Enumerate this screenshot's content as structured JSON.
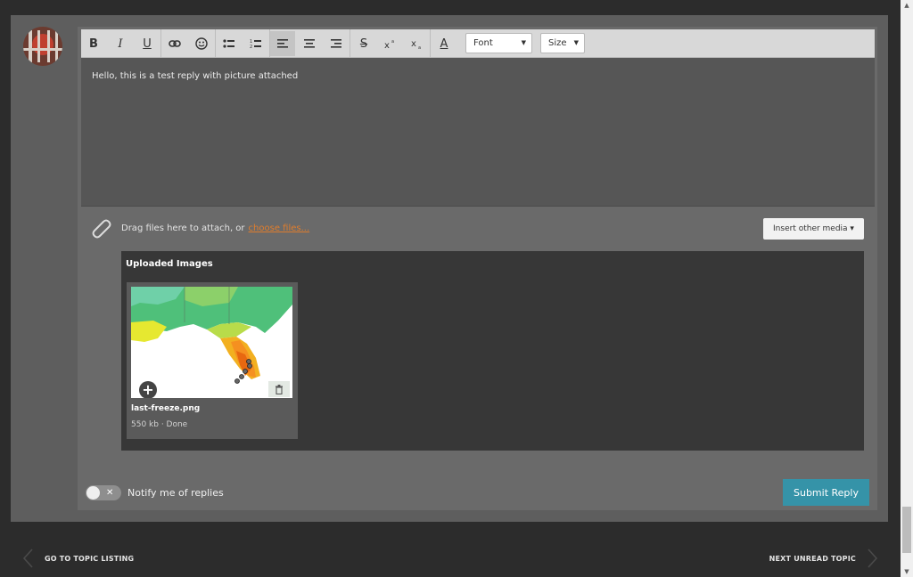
{
  "toolbar": {
    "bold": "B",
    "italic": "I",
    "underline": "U",
    "strike": "S",
    "text_color": "A",
    "font_label": "Font",
    "size_label": "Size",
    "icons": [
      "bold-icon",
      "italic-icon",
      "underline-icon",
      "link-icon",
      "emoji-icon",
      "bullet-list-icon",
      "numbered-list-icon",
      "align-left-icon",
      "align-center-icon",
      "align-right-icon",
      "strikethrough-icon",
      "superscript-icon",
      "subscript-icon",
      "text-color-icon"
    ]
  },
  "editor": {
    "content": "Hello, this is a test reply with picture attached"
  },
  "attach": {
    "text": "Drag files here to attach, or",
    "link": "choose files...",
    "insert_media": "Insert other media ▾"
  },
  "uploads": {
    "title": "Uploaded Images",
    "items": [
      {
        "file_name": "last-freeze.png",
        "meta": "550 kb · Done"
      }
    ]
  },
  "notify": {
    "label": "Notify me of replies",
    "enabled": false
  },
  "submit": {
    "label": "Submit Reply"
  },
  "nav": {
    "prev_label": "GO TO TOPIC LISTING",
    "next_label": "NEXT UNREAD TOPIC"
  },
  "colors": {
    "page_bg": "#2c2c2c",
    "panel_bg": "#5e5e5e",
    "accent_submit": "#3593a8",
    "link_orange": "#e07d2c"
  }
}
